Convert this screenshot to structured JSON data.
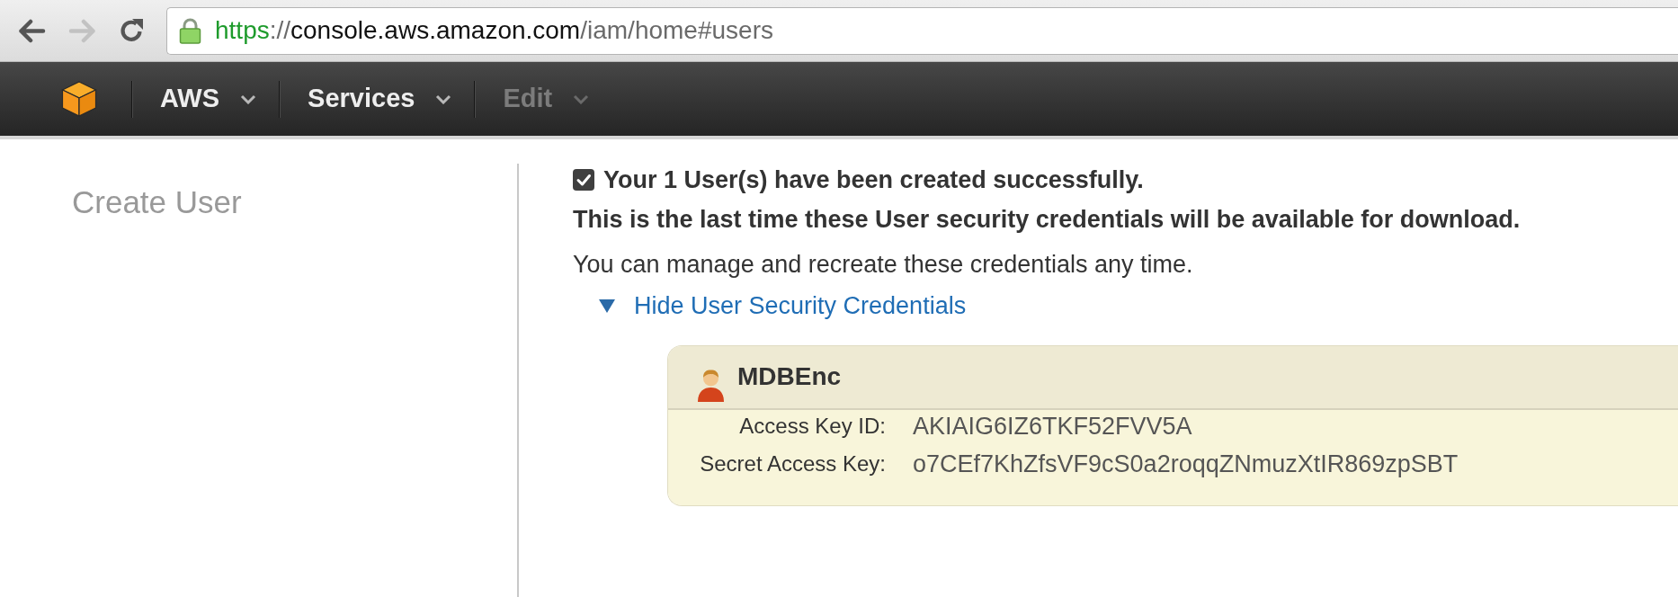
{
  "browser": {
    "nav": [
      {
        "kind": "back",
        "disabled": false
      },
      {
        "kind": "forward",
        "disabled": true
      },
      {
        "kind": "reload",
        "disabled": false
      }
    ],
    "secure": true,
    "url": [
      {
        "text": "https",
        "kind": "scheme"
      },
      {
        "text": "://",
        "kind": "other"
      },
      {
        "text": "console.aws.amazon.com",
        "kind": "host"
      },
      {
        "text": "/iam/home#users",
        "kind": "other"
      }
    ]
  },
  "navbar": {
    "menus": [
      {
        "label": "AWS",
        "disabled": false
      },
      {
        "label": "Services",
        "disabled": false
      },
      {
        "label": "Edit",
        "disabled": true
      }
    ]
  },
  "sidebar": {
    "title": "Create User"
  },
  "main": {
    "success": {
      "checked": true,
      "text": "Your 1 User(s) have been created successfully."
    },
    "warning": "This is the last time these User security credentials will be available for download.",
    "note": "You can manage and recreate these credentials any time.",
    "toggle": {
      "label": "Hide User Security Credentials",
      "expanded": true
    },
    "credentials": {
      "user": "MDBEnc",
      "fields": [
        {
          "label": "Access Key ID:",
          "value": "AKIAIG6IZ6TKF52FVV5A"
        },
        {
          "label": "Secret Access Key:",
          "value": "o7CEf7KhZfsVF9cS0a2roqqZNmuzXtIR869zpSBT"
        }
      ]
    }
  }
}
